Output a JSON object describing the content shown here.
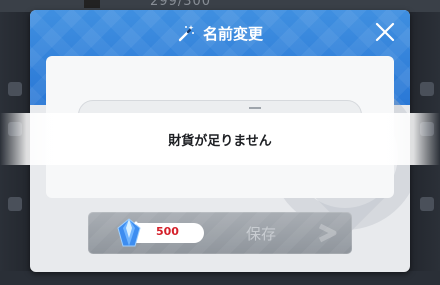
{
  "background": {
    "counter_text": "299/300"
  },
  "dialog": {
    "title": "名前変更",
    "title_icon": "magic-wand-icon",
    "close_icon": "close-icon",
    "accent_color": "#2a78d6"
  },
  "save_button": {
    "label": "保存",
    "cost_value": "500",
    "cost_currency_icon": "blue-gem-icon",
    "cost_color": "#d4202a"
  },
  "toast": {
    "message": "財貨が足りません"
  }
}
